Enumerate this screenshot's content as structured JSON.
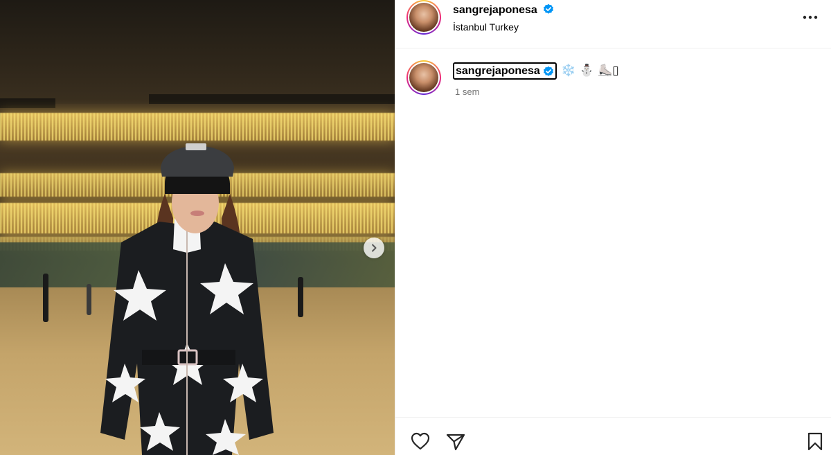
{
  "post": {
    "username": "sangrejaponesa",
    "location": "İstanbul Turkey",
    "media_alt": "woman in star-print leather ski suit at ice rink"
  },
  "caption": {
    "username": "sangrejaponesa",
    "emojis": "❄️ ⛄ ⛸️▯",
    "time": "1 sem"
  },
  "icons": {
    "verified": "verified-badge-icon",
    "more": "more-options-icon",
    "next": "chevron-right-icon",
    "like": "heart-icon",
    "share": "send-icon",
    "save": "bookmark-icon"
  },
  "colors": {
    "verified": "#0095f6",
    "muted": "#737373",
    "divider": "#efefef"
  }
}
